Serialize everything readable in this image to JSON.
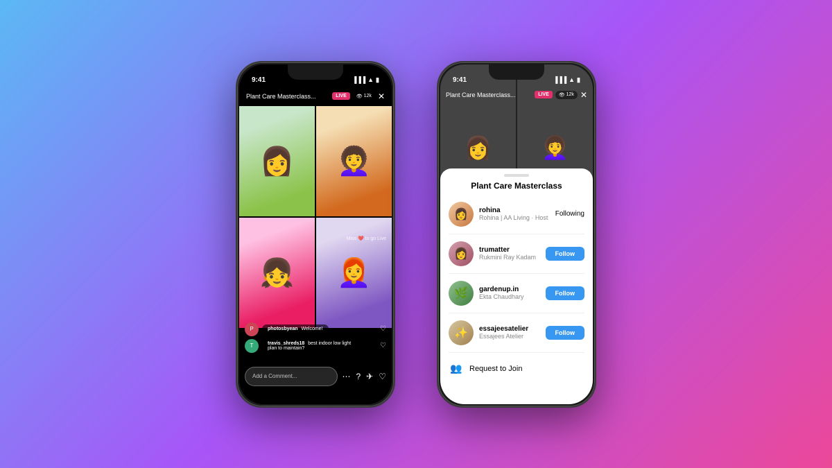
{
  "background": "linear-gradient(135deg, #5bb8f5 0%, #a855f7 50%, #ec4899 100%)",
  "left_phone": {
    "status_time": "9:41",
    "live_title": "Plant Care Masterclass...",
    "live_badge": "LIVE",
    "viewer_count": "12k",
    "close_icon": "✕",
    "miss_text": "Miss ❤️ to go Live",
    "comments": [
      {
        "user": "photosbyean",
        "text": "Welcome!",
        "avatar_letter": "P"
      },
      {
        "user": "travis_shreds18",
        "text": "best indoor low light plan to maintain?",
        "avatar_letter": "T"
      }
    ],
    "comment_placeholder": "Add a Comment...",
    "bottom_icons": [
      "⋯",
      "?",
      "✈",
      "♡"
    ]
  },
  "right_phone": {
    "status_time": "9:41",
    "live_title": "Plant Care Masterclass...",
    "live_badge": "LIVE",
    "viewer_count": "12k",
    "close_icon": "✕",
    "sheet_title": "Plant Care Masterclass",
    "users": [
      {
        "handle": "rohina",
        "subtitle": "Rohina | AA Living · Host",
        "action": "Following",
        "action_type": "text",
        "avatar_class": "av-rohina",
        "avatar_emoji": "👩"
      },
      {
        "handle": "trumatter",
        "subtitle": "Rukmini Ray Kadam",
        "action": "Follow",
        "action_type": "button",
        "avatar_class": "av-trumatter",
        "avatar_emoji": "👩"
      },
      {
        "handle": "gardenup.in",
        "subtitle": "Ekta Chaudhary",
        "action": "Follow",
        "action_type": "button",
        "avatar_class": "av-gardenup",
        "avatar_emoji": "🌿"
      },
      {
        "handle": "essajeesatelier",
        "subtitle": "Essajees Atelier",
        "action": "Follow",
        "action_type": "button",
        "avatar_class": "av-essajees",
        "avatar_emoji": "✨"
      }
    ],
    "request_text": "Request to Join",
    "request_icon": "👥"
  }
}
